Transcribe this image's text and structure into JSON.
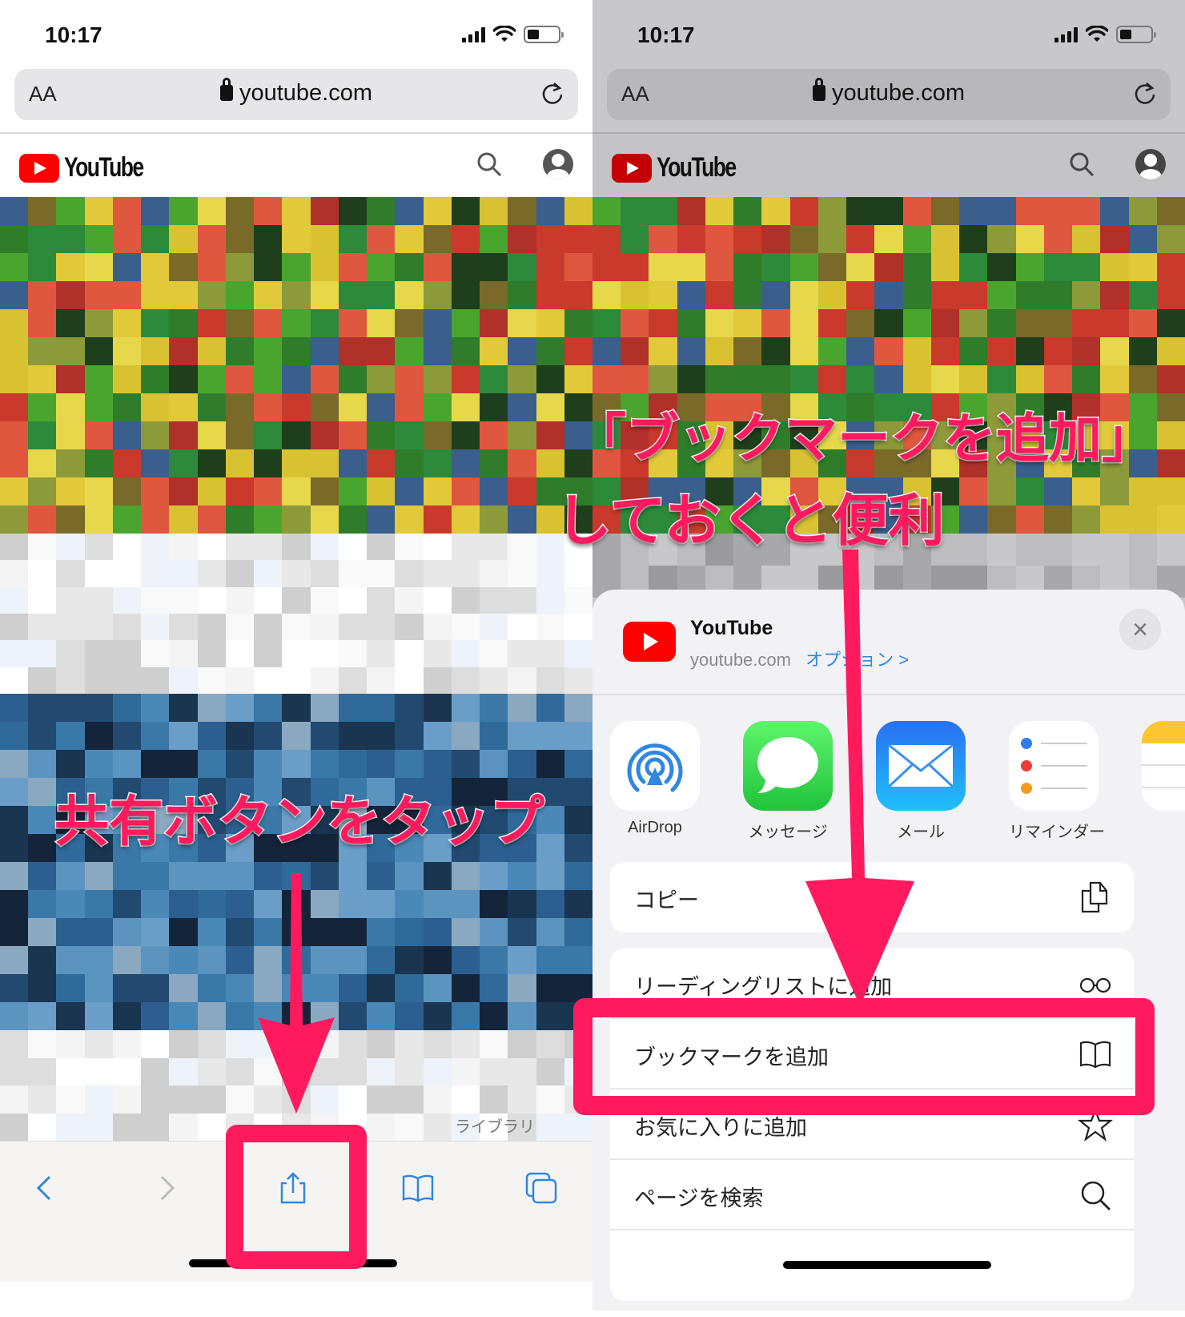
{
  "left": {
    "status": {
      "time": "10:17"
    },
    "urlbar": {
      "text_size_label": "AA",
      "url": "youtube.com"
    },
    "youtube": {
      "logo_text": "YouTube"
    },
    "library_label": "ライブラリ",
    "annotation": "共有ボタンをタップ",
    "toolbar": {
      "back": "back-icon",
      "forward": "forward-icon",
      "share": "share-icon",
      "bookmarks": "bookmarks-icon",
      "tabs": "tabs-icon"
    }
  },
  "right": {
    "status": {
      "time": "10:17"
    },
    "urlbar": {
      "text_size_label": "AA",
      "url": "youtube.com"
    },
    "youtube": {
      "logo_text": "YouTube"
    },
    "annotation_line1": "「ブックマークを追加」",
    "annotation_line2": "しておくと便利",
    "share_sheet": {
      "title": "YouTube",
      "subtitle": "youtube.com",
      "options_link": "オプション >",
      "close_label": "×",
      "apps": [
        {
          "label": "AirDrop",
          "icon": "airdrop-icon"
        },
        {
          "label": "メッセージ",
          "icon": "messages-icon"
        },
        {
          "label": "メール",
          "icon": "mail-icon"
        },
        {
          "label": "リマインダー",
          "icon": "reminders-icon"
        },
        {
          "label": "",
          "icon": "notes-icon"
        }
      ],
      "actions": [
        {
          "label": "コピー",
          "icon": "copy-icon"
        },
        {
          "label": "リーディングリストに追加",
          "icon": "glasses-icon"
        },
        {
          "label": "ブックマークを追加",
          "icon": "book-icon",
          "highlighted": true
        },
        {
          "label": "お気に入りに追加",
          "icon": "star-icon"
        },
        {
          "label": "ページを検索",
          "icon": "search-icon"
        }
      ]
    }
  },
  "colors": {
    "annotation": "#ff1a5e",
    "youtube_red": "#ff0000",
    "ios_blue": "#2f87e2"
  }
}
